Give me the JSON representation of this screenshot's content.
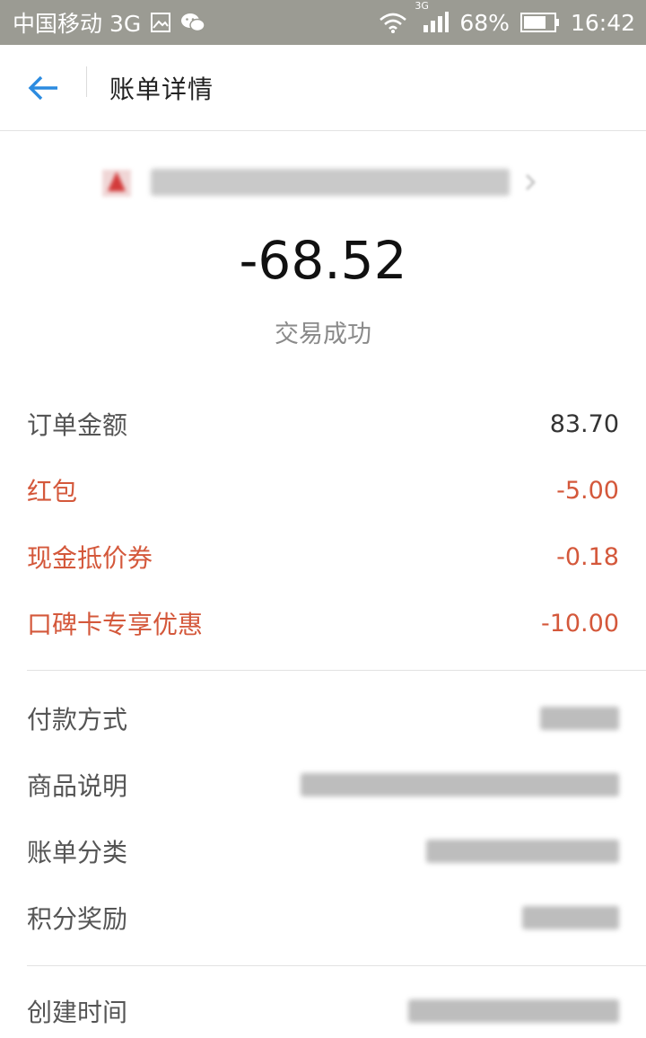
{
  "status_bar": {
    "carrier": "中国移动 3G",
    "battery": "68%",
    "time": "16:42",
    "signal_tag": "3G",
    "icons": [
      "image-icon",
      "wechat-icon",
      "wifi-icon",
      "signal-icon",
      "battery-icon"
    ]
  },
  "header": {
    "title": "账单详情",
    "back_icon": "back-arrow-icon"
  },
  "merchant": {
    "name": "",
    "logo_icon": "merchant-logo-icon"
  },
  "summary": {
    "amount": "-68.52",
    "status": "交易成功"
  },
  "colors": {
    "discount": "#d4583b",
    "status_bar": "#9b9b93",
    "back_arrow": "#2b8be0"
  },
  "breakdown": [
    {
      "label": "订单金额",
      "value": "83.70"
    },
    {
      "label": "红包",
      "value": "-5.00"
    },
    {
      "label": "现金抵价券",
      "value": "-0.18"
    },
    {
      "label": "口碑卡专享优惠",
      "value": "-10.00"
    }
  ],
  "details": [
    {
      "label": "付款方式",
      "value": ""
    },
    {
      "label": "商品说明",
      "value": ""
    },
    {
      "label": "账单分类",
      "value": ""
    },
    {
      "label": "积分奖励",
      "value": ""
    }
  ],
  "meta": [
    {
      "label": "创建时间",
      "value": ""
    }
  ]
}
